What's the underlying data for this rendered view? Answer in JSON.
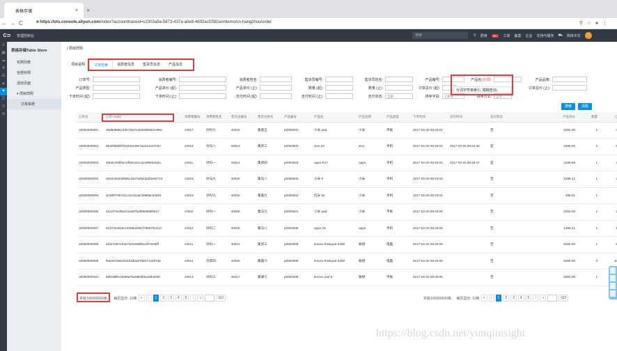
{
  "browser": {
    "tab_title": "表格存储",
    "new_tab": "+",
    "close": "×",
    "url_scheme": "https://",
    "url_host": "ots.console.aliyun.com",
    "url_path": "/index?accounttraceid=c2303a5a-5873-437a-a0e8-4692acf2581e#/demo/cn-hangzhou/order",
    "back": "←",
    "forward": "→",
    "reload": "C"
  },
  "topnav": {
    "logo": "C⊃",
    "title": "管理控制台",
    "search_placeholder": "搜索",
    "items": [
      "费用",
      "工单",
      "备案",
      "企业",
      "支持与服务",
      "简体中文"
    ],
    "badge": "99+"
  },
  "sidebar": {
    "title": "表格存储Table Store",
    "items": [
      "实例列表",
      "全部实例",
      "活动页面"
    ],
    "group": "▾ 项目样例",
    "sub": "订单系统"
  },
  "breadcrumb": "项目样例",
  "subtabs": [
    "项目说明",
    "订单检索",
    "消费者信息",
    "售货员信息",
    "产品信息"
  ],
  "filters": {
    "order_no": "订单号:",
    "consumer_no": "消费者编号:",
    "consumer_name": "消费者姓名:",
    "seller_no": "售货员编号:",
    "seller_name": "售货员姓名:",
    "product_no": "产品编号:",
    "product_name": "产品名",
    "product_name_hint": "(分词)",
    "product_brand": "产品品牌:",
    "product_type": "产品类型:",
    "unit_price": "产品单价 (起):",
    "unit_price_to": "产品单价 (止):",
    "qty_from": "数量 (起):",
    "qty_to": "数量 (止):",
    "total_from": "订单总价 (起):",
    "total_to": "订单总价 (止):",
    "order_time_from": "下单时间 (起):",
    "order_time_to": "下单时间 (止):",
    "pay_time_from": "支付时间 (起):",
    "pay_time_to": "支付时间 (止):",
    "pay_status": "支付状态:",
    "pay_status_value": "全部",
    "sort_field": "排序字段:",
    "sort_field_value": "订单号",
    "sort_dir": "排序方式:",
    "sort_dir_value": "正序",
    "tooltip": "分词字符串索引, 模糊查询。",
    "search_btn": "搜索",
    "clear_btn": "清除"
  },
  "table": {
    "columns": [
      "订单号",
      "订单 (md5)",
      "消费者编号",
      "消费者姓名",
      "售货员编号",
      "售货员姓名",
      "产品编号",
      "产品名",
      "产品品牌",
      "产品类型",
      "下单时间",
      "支付时间",
      "支付状态",
      "产品单价",
      "数量",
      "订单总价"
    ],
    "rows": [
      [
        "o0000000001",
        "39d9d9881cb9729a7e48269b6bd1395c",
        "c0017",
        "孙吗七",
        "s0015",
        "集嘉五",
        "p0005001",
        "小米 pad",
        "小米",
        "平板",
        "2017-03-20 09:20:01",
        "",
        "否",
        "2002.00",
        "2",
        "4004.00"
      ],
      [
        "o0000000002",
        "953ef9dd9f7b0291148e7aa331227037",
        "c0018",
        "孙马八",
        "s0013",
        "集弥三",
        "p0003002",
        "vivo Z3",
        "vivo",
        "手机",
        "2017-03-20 09:20:02",
        "2017-03-20 09:22:35",
        "是",
        "3498.00",
        "2",
        "6996.00"
      ],
      [
        "o0000000003",
        "49e8c293f0a72fb0e161c2248963e55a",
        "c0011",
        "孙吗一",
        "s0014",
        "集弥四",
        "p0004003",
        "oppo R17",
        "oppo",
        "手机",
        "2017-03-20 09:20:02",
        "2017-03-20 09:29:47",
        "是",
        "3199.98",
        "1",
        "3199.98"
      ],
      [
        "o0000000004",
        "e634c6eb3d965c15e7a0943d2be62724",
        "c0019",
        "孙马九",
        "s0018",
        "集马八",
        "p0005003",
        "小米 6",
        "小米",
        "手机",
        "2017-03-20 09:20:03",
        "",
        "否",
        "2299.21",
        "1",
        "2299.21"
      ],
      [
        "o0000000005",
        "dc06f079b7d1c41231aec09655c94583",
        "c0019",
        "孙吗九",
        "s0019",
        "集嘉九",
        "p0005004",
        "红米 5s",
        "小米",
        "手机",
        "2017-03-20 09:20:04",
        "",
        "否",
        "499.01",
        "1",
        "499.01"
      ],
      [
        "o0000000006",
        "3111f73cd0ac01a387baf89e869f6617",
        "c0022",
        "孙吗一",
        "s0009",
        "集马九",
        "p0005001",
        "小米 pad",
        "小米",
        "平板",
        "2017-03-20 09:20:05",
        "",
        "否",
        "2002.00",
        "1",
        "2002.00"
      ],
      [
        "o0000000007",
        "61474e2616cc4068a456cf788979141d",
        "c0012",
        "孙吗二",
        "s0018",
        "集马八",
        "p0004005",
        "oppo A5",
        "oppo",
        "手机",
        "2017-03-20 09:20:05",
        "",
        "否",
        "1299.21",
        "1",
        "1299.21"
      ],
      [
        "o0000000008",
        "4d117d67e29e72e0259fb5cdf74048ff",
        "c0011",
        "孙吗一",
        "s0013",
        "集弥三",
        "p0002008",
        "lenovo thinkpad E450",
        "联想",
        "电脑",
        "2017-03-20 09:20:05",
        "",
        "否",
        "6000.00",
        "1",
        "6000.00"
      ],
      [
        "o0000000009",
        "f8ae6cf455c94404dba075b0712297a8",
        "c0014",
        "孙李四",
        "s0016",
        "集嘉六",
        "p0002009",
        "lenovo thinkpad E450",
        "联想",
        "电脑",
        "2017-03-20 09:20:05",
        "",
        "否",
        "6000.00",
        "3",
        "18000.00"
      ],
      [
        "o0000000010",
        "85f636ffe24059a7be9803bba28b2930",
        "c0013",
        "孙吗三",
        "s0017",
        "集驿七",
        "p0002006",
        "lenovo pad 6",
        "联想",
        "平板",
        "2017-03-20 09:20:06",
        "",
        "否",
        "2000.00",
        "1",
        "2000.00"
      ]
    ]
  },
  "pager": {
    "total": "共有100000000条,",
    "per_page": "每页显示: 10条",
    "first": "«",
    "prev": "‹",
    "pages": [
      "1",
      "2",
      "3",
      "4",
      "5"
    ],
    "next": "›",
    "last": "»",
    "go": "GO"
  },
  "watermark": "https://blog.csdn.net/yunqiinsight"
}
